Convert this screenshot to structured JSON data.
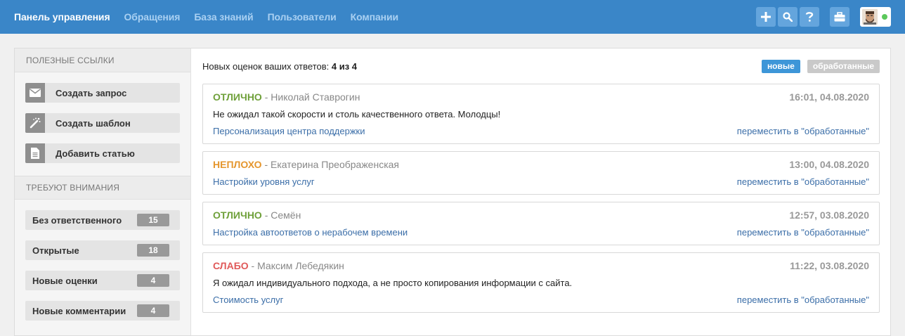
{
  "nav": {
    "items": [
      "Панель управления",
      "Обращения",
      "База знаний",
      "Пользователи",
      "Компании"
    ]
  },
  "toolbar": {
    "icons": [
      "plus-icon",
      "search-icon",
      "help-icon",
      "briefcase-icon"
    ],
    "status_color": "#5bc85b"
  },
  "sidebar": {
    "links_title": "Полезные ссылки",
    "links": [
      {
        "label": "Создать запрос",
        "icon": "envelope-icon"
      },
      {
        "label": "Создать шаблон",
        "icon": "magic-wand-icon"
      },
      {
        "label": "Добавить статью",
        "icon": "document-icon"
      }
    ],
    "attention_title": "Требуют внимания",
    "attention": [
      {
        "label": "Без ответственного",
        "count": "15"
      },
      {
        "label": "Открытые",
        "count": "18"
      },
      {
        "label": "Новые оценки",
        "count": "4"
      },
      {
        "label": "Новые комментарии",
        "count": "4"
      }
    ]
  },
  "main": {
    "header_prefix": "Новых оценок ваших ответов: ",
    "header_count": "4 из 4",
    "filters": {
      "new": "новые",
      "done": "обработанные"
    },
    "cards": [
      {
        "rating": "ОТЛИЧНО",
        "author": " - Николай Ставрогин",
        "time": "16:01, 04.08.2020",
        "comment": "Не ожидал такой скорости и столь качественного ответа. Молодцы!",
        "article": "Персонализация центра поддержки",
        "move": "переместить в \"обработанные\""
      },
      {
        "rating": "НЕПЛОХО",
        "author": " - Екатерина Преображенская",
        "time": "13:00, 04.08.2020",
        "comment": "",
        "article": "Настройки уровня услуг",
        "move": "переместить в \"обработанные\""
      },
      {
        "rating": "ОТЛИЧНО",
        "author": " - Семён",
        "time": "12:57, 03.08.2020",
        "comment": "",
        "article": "Настройка автоответов о нерабочем времени",
        "move": "переместить в \"обработанные\""
      },
      {
        "rating": "СЛАБО",
        "author": " - Максим Лебедякин",
        "time": "11:22, 03.08.2020",
        "comment": "Я ожидал индивидуального подхода, а не просто копирования информации с сайта.",
        "article": "Стоимость услуг",
        "move": "переместить в \"обработанные\""
      }
    ]
  },
  "colors": {
    "accent": "#3a86c8",
    "good": "#6fa03a",
    "ok": "#e5962d",
    "bad": "#e05a5a"
  }
}
